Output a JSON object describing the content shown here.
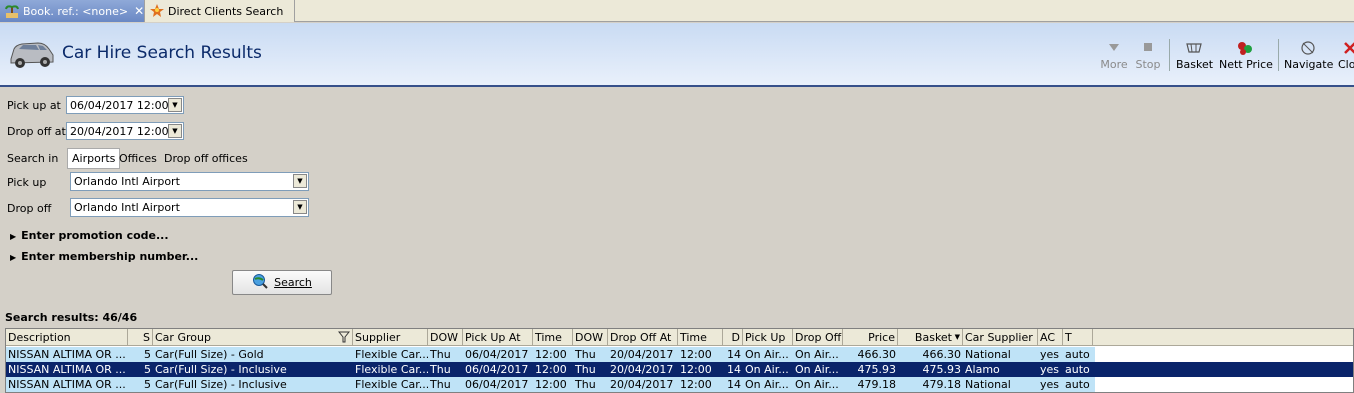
{
  "tabs": [
    {
      "label": "Book. ref.: <none>",
      "icon": "palm-icon"
    },
    {
      "label": "Direct Clients Search",
      "icon": "star-person-icon"
    }
  ],
  "header": {
    "title": "Car Hire Search Results"
  },
  "toolbar": {
    "more": "More",
    "stop": "Stop",
    "basket": "Basket",
    "nett_price": "Nett Price",
    "navigate": "Navigate",
    "close": "Close"
  },
  "form": {
    "pickup_at_label": "Pick up at",
    "pickup_at_value": "06/04/2017 12:00",
    "dropoff_at_label": "Drop off at",
    "dropoff_at_value": "20/04/2017 12:00",
    "search_in_label": "Search in",
    "search_in_options": [
      "Airports",
      "Offices",
      "Drop off offices"
    ],
    "pickup_label": "Pick up",
    "pickup_value": "Orlando Intl Airport",
    "dropoff_label": "Drop off",
    "dropoff_value": "Orlando Intl Airport",
    "promo": "Enter promotion code...",
    "membership": "Enter membership number...",
    "search_button": "Search"
  },
  "results": {
    "label": "Search results: 46/46"
  },
  "grid": {
    "columns": [
      "Description",
      "S",
      "Car Group",
      "Supplier",
      "DOW",
      "Pick Up At",
      "Time",
      "DOW",
      "Drop Off At",
      "Time",
      "D",
      "Pick Up",
      "Drop Off",
      "Price",
      "Basket",
      "Car Supplier",
      "AC",
      "T"
    ],
    "rows": [
      [
        "NISSAN ALTIMA OR ...",
        "5",
        "Car(Full Size) - Gold",
        "Flexible Car...",
        "Thu",
        "06/04/2017",
        "12:00",
        "Thu",
        "20/04/2017",
        "12:00",
        "14",
        "On Air...",
        "On Air...",
        "466.30",
        "466.30",
        "National",
        "yes",
        "auto"
      ],
      [
        "NISSAN ALTIMA OR ...",
        "5",
        "Car(Full Size) - Inclusive",
        "Flexible Car...",
        "Thu",
        "06/04/2017",
        "12:00",
        "Thu",
        "20/04/2017",
        "12:00",
        "14",
        "On Air...",
        "On Air...",
        "475.93",
        "475.93",
        "Alamo",
        "yes",
        "auto"
      ],
      [
        "NISSAN ALTIMA OR ...",
        "5",
        "Car(Full Size) - Inclusive",
        "Flexible Car...",
        "Thu",
        "06/04/2017",
        "12:00",
        "Thu",
        "20/04/2017",
        "12:00",
        "14",
        "On Air...",
        "On Air...",
        "479.18",
        "479.18",
        "National",
        "yes",
        "auto"
      ]
    ]
  }
}
